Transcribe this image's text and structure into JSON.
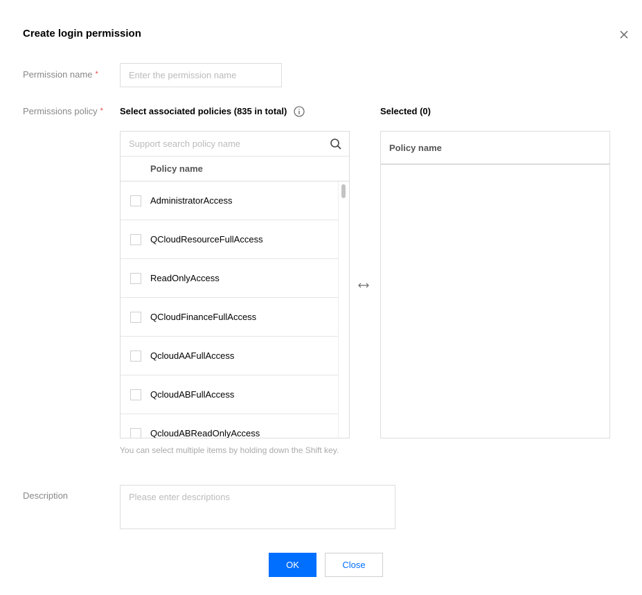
{
  "dialog": {
    "title": "Create login permission"
  },
  "form": {
    "permission_name_label": "Permission name",
    "permission_name_placeholder": "Enter the permission name",
    "permissions_policy_label": "Permissions policy",
    "required_marker": "*",
    "description_label": "Description",
    "description_placeholder": "Please enter descriptions"
  },
  "policy_selector": {
    "left_title": "Select associated policies (835 in total)",
    "search_placeholder": "Support search policy name",
    "column_header": "Policy name",
    "items": [
      {
        "label": "AdministratorAccess",
        "checked": false
      },
      {
        "label": "QCloudResourceFullAccess",
        "checked": false
      },
      {
        "label": "ReadOnlyAccess",
        "checked": false
      },
      {
        "label": "QCloudFinanceFullAccess",
        "checked": false
      },
      {
        "label": "QcloudAAFullAccess",
        "checked": false
      },
      {
        "label": "QcloudABFullAccess",
        "checked": false
      },
      {
        "label": "QcloudABReadOnlyAccess",
        "checked": false
      }
    ],
    "right_title": "Selected (0)",
    "right_column_header": "Policy name",
    "hint": "You can select multiple items by holding down the Shift key."
  },
  "buttons": {
    "ok": "OK",
    "close": "Close"
  },
  "colors": {
    "primary": "#006eff",
    "required": "#e54545"
  },
  "icons": {
    "close": "close-icon",
    "info": "info-icon",
    "search": "search-icon",
    "swap": "swap-arrows-icon"
  }
}
